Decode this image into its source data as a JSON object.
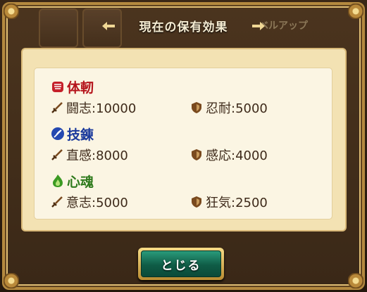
{
  "dialog": {
    "title": "現在の保有効果",
    "background_label": "ベルアップ",
    "close_label": "とじる"
  },
  "categories": [
    {
      "name": "体軔",
      "color": "#b5141c",
      "icon": "fist-icon",
      "stats": [
        {
          "icon": "sword-icon",
          "label": "闘志:10000"
        },
        {
          "icon": "shield-icon",
          "label": "忍耐:5000"
        }
      ]
    },
    {
      "name": "技錬",
      "color": "#1b3a9c",
      "icon": "feather-icon",
      "stats": [
        {
          "icon": "sword-icon",
          "label": "直感:8000"
        },
        {
          "icon": "shield-icon",
          "label": "感応:4000"
        }
      ]
    },
    {
      "name": "心魂",
      "color": "#2e7a1c",
      "icon": "flame-icon",
      "stats": [
        {
          "icon": "sword-icon",
          "label": "意志:5000"
        },
        {
          "icon": "shield-icon",
          "label": "狂気:2500"
        }
      ]
    }
  ],
  "colors": {
    "frame_gold": "#b4893f",
    "parchment": "#f3e2b3",
    "button_green": "#0f5c46",
    "stat_text": "#3e2a1a"
  }
}
